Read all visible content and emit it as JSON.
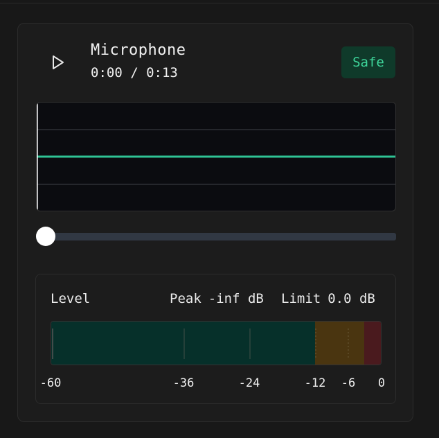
{
  "player": {
    "title": "Microphone",
    "time": "0:00 / 0:13",
    "badge": "Safe",
    "playback_progress": 0
  },
  "meter": {
    "label": "Level",
    "peak_label": "Peak",
    "peak_value": "-inf dB",
    "limit_label": "Limit",
    "limit_value": "0.0 dB",
    "scale_ticks": [
      "-60",
      "-36",
      "-24",
      "-12",
      "-6",
      "0"
    ],
    "scale_values_db": [
      -60,
      -36,
      -24,
      -12,
      -6,
      0
    ],
    "zones": [
      {
        "from_db": -60,
        "to_db": -12,
        "color": "#06302a"
      },
      {
        "from_db": -12,
        "to_db": -3,
        "color": "#4a3510"
      },
      {
        "from_db": -3,
        "to_db": 0,
        "color": "#4a1a1e"
      }
    ]
  },
  "colors": {
    "accent": "#3ed69b",
    "waveform": "#2fc495",
    "badge_bg": "#0f3a2a"
  }
}
